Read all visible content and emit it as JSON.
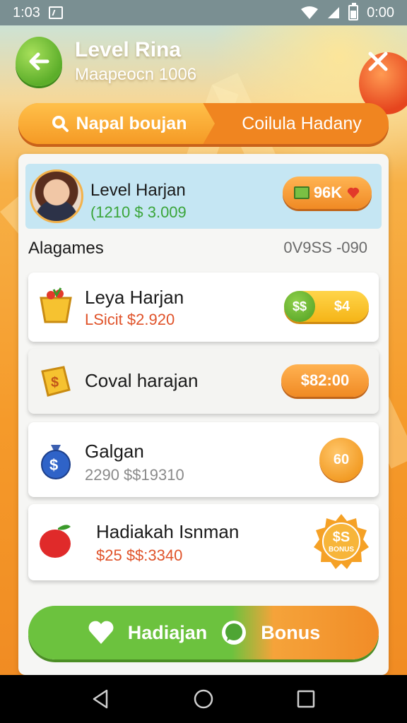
{
  "status_bar": {
    "time": "1:03",
    "clock_right": "0:00"
  },
  "header": {
    "title": "Level Rina",
    "subtitle": "Maapeocn 1006"
  },
  "tabs": [
    {
      "label": "Napal boujan"
    },
    {
      "label": "Coilula Hadany"
    }
  ],
  "profile": {
    "name": "Level Harjan",
    "amount": "(1210 $ 3.009",
    "badge_value": "96K"
  },
  "section": {
    "label": "Alagames",
    "value": "0V9SS -090"
  },
  "items": [
    {
      "title": "Leya Harjan",
      "subtitle": "LSicit $2.920",
      "pill_left": "$$",
      "pill_right": "$4"
    },
    {
      "title": "Coval harajan",
      "price": "$82:00"
    },
    {
      "title": "Galgan",
      "subtitle": "2290 $$19310",
      "coin": "60"
    },
    {
      "title": "Hadiakah Isnman",
      "subtitle": "$25 $$:3340",
      "seal_top": "$S",
      "seal_bottom": "BONUS"
    }
  ],
  "bonus_button": {
    "left_label": "Hadiajan",
    "right_label": "Bonus"
  },
  "colors": {
    "accent_orange": "#f08a24",
    "accent_green": "#6cc23e",
    "profile_bg": "#c5e6f3"
  }
}
